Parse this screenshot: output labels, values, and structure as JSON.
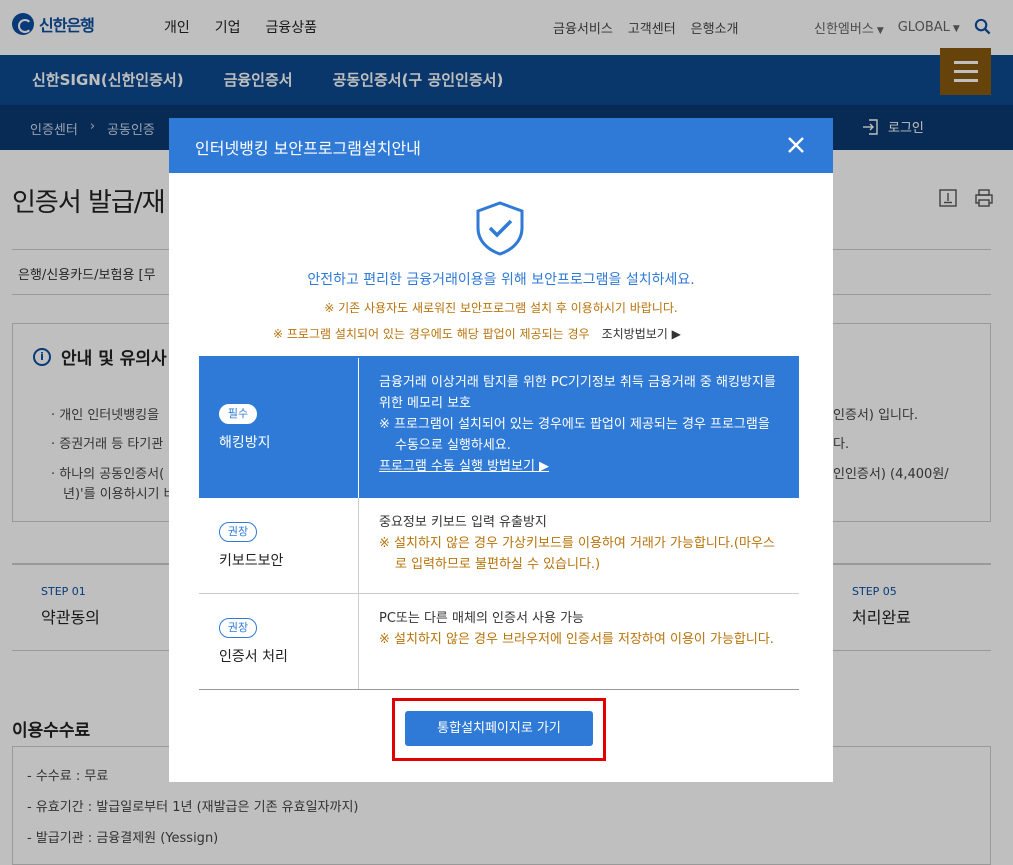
{
  "header": {
    "logo_text": "신한은행",
    "main_nav": [
      "개인",
      "기업",
      "금융상품"
    ],
    "util_nav": [
      "금융서비스",
      "고객센터",
      "은행소개"
    ],
    "right_nav": [
      "신한엠버스",
      "GLOBAL"
    ]
  },
  "blue_bar": {
    "tabs": [
      "신한SIGN(신한인증서)",
      "금융인증서",
      "공동인증서(구 공인인증서)"
    ],
    "breadcrumb": [
      "인증센터",
      "공동인증"
    ],
    "login_label": "로그인"
  },
  "page": {
    "title": "인증서 발급/재",
    "subline": "은행/신용카드/보험용 [무",
    "notice_title": "안내 및 유의사",
    "notice_lines": [
      "개인 인터넷뱅킹을",
      "증권거래 등 타기관",
      "하나의 공동인증서(",
      "년)'를 이용하시기 바"
    ],
    "notice_right": [
      "인증서) 입니다.",
      "다.",
      "인인증서) (4,400원/"
    ],
    "steps": [
      {
        "num": "STEP 01",
        "label": "약관동의"
      },
      {
        "num": "STEP 05",
        "label": "처리완료"
      }
    ],
    "fee_title": "이용수수료",
    "fee_lines": [
      "수수료 : 무료",
      "유효기간 : 발급일로부터 1년 (재발급은 기존 유효일자까지)",
      "발급기관 : 금융결제원 (Yessign)"
    ]
  },
  "modal": {
    "title": "인터넷뱅킹 보안프로그램설치안내",
    "message": "안전하고 편리한 금융거래이용을 위해 보안프로그램을 설치하세요.",
    "sub_notice_1": "※ 기존 사용자도 새로워진 보안프로그램 설치 후 이용하시기 바랍니다.",
    "sub_notice_2": "※ 프로그램 설치되어 있는 경우에도 해당 팝업이 제공되는 경우",
    "howto_link": "조치방법보기 ▶",
    "programs": [
      {
        "badge": "필수",
        "name": "해킹방지",
        "desc": "금융거래 이상거래 탐지를 위한 PC기기정보 취득 금융거래 중 해킹방지를 위한 메모리 보호",
        "warn": "※ 프로그램이 설치되어 있는 경우에도 팝업이 제공되는 경우 프로그램을 수동으로 실행하세요.",
        "link": "프로그램 수동 실행 방법보기 ▶"
      },
      {
        "badge": "권장",
        "name": "키보드보안",
        "desc": "중요정보 키보드 입력 유출방지",
        "warn": "※ 설치하지 않은 경우 가상키보드를 이용하여 거래가 가능합니다.(마우스로 입력하므로 불편하실 수 있습니다.)"
      },
      {
        "badge": "권장",
        "name": "인증서 처리",
        "desc": "PC또는 다른 매체의 인증서 사용 가능",
        "warn": "※ 설치하지 않은 경우 브라우저에 인증서를 저장하여 이용이 가능합니다."
      }
    ],
    "go_button": "통합설치페이지로 가기"
  },
  "colors": {
    "brand_blue": "#0b4ea2",
    "modal_blue": "#2f7ad6",
    "warn_orange": "#b8730a",
    "highlight_red": "#e00000"
  }
}
